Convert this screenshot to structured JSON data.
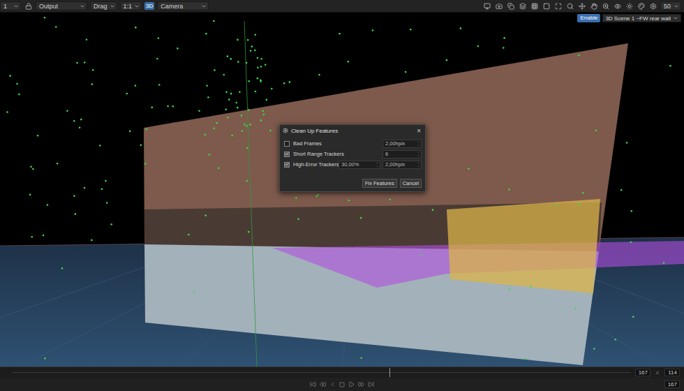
{
  "toolbar": {
    "view": "1",
    "items": [
      {
        "label": "Output",
        "kind": "dropdown"
      },
      {
        "label": "Drag",
        "kind": "dropdown"
      },
      {
        "label": "1:1",
        "kind": "dropdown"
      },
      {
        "label": "3D",
        "kind": "badge"
      },
      {
        "label": "Camera",
        "kind": "dropdown"
      }
    ],
    "zoom": "50"
  },
  "view_bar": {
    "enable": {
      "label": "Enable",
      "on": true
    },
    "scene": "3D Scene 1 ~FW rear wall"
  },
  "dialog": {
    "title": "Clean Up Features",
    "close": "×",
    "rows": [
      {
        "label": "Bad Frames",
        "checked": false,
        "fields": [
          "2,00hpix"
        ]
      },
      {
        "label": "Short Range Trackers",
        "checked": true,
        "fields": [
          "6"
        ]
      },
      {
        "label": "High-Error Trackers",
        "checked": true,
        "fields": [
          "30,00%",
          "2,00hpix"
        ]
      }
    ],
    "buttons": [
      {
        "label": "Fix Features"
      },
      {
        "label": "Cancel"
      }
    ]
  },
  "timeline": {
    "level": 0.61,
    "end": "167",
    "current": "114"
  },
  "transport": {
    "frame": "167"
  }
}
